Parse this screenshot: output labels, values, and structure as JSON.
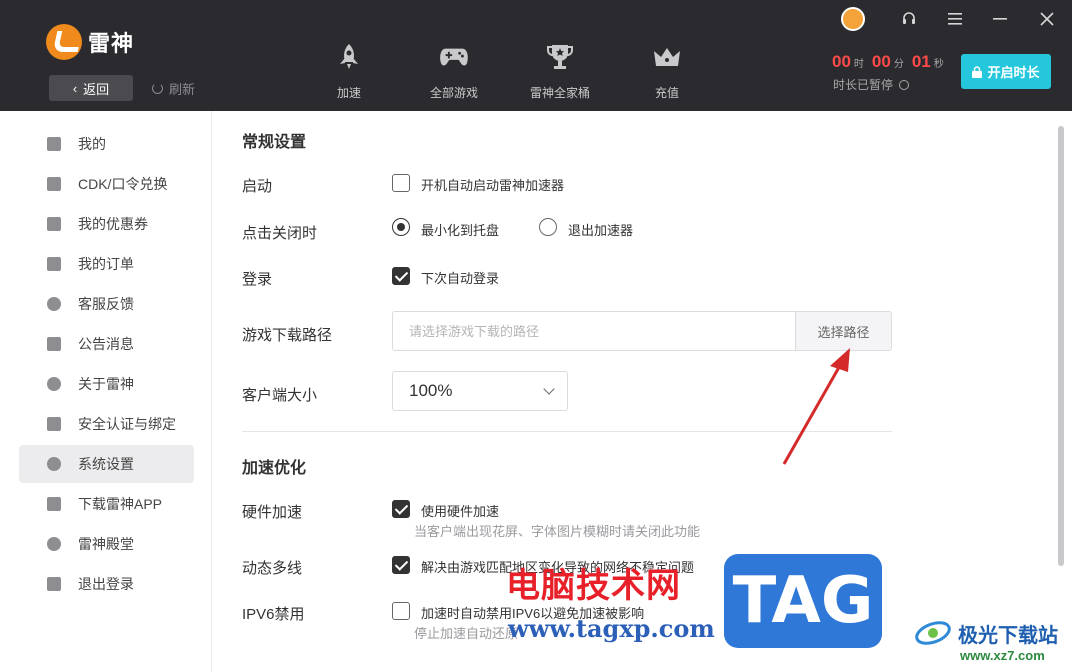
{
  "app": {
    "name": "雷神"
  },
  "header": {
    "back_label": "返回",
    "refresh_label": "刷新",
    "nav": [
      {
        "label": "加速",
        "icon": "rocket-icon"
      },
      {
        "label": "全部游戏",
        "icon": "gamepad-icon"
      },
      {
        "label": "雷神全家桶",
        "icon": "trophy-icon"
      },
      {
        "label": "充值",
        "icon": "crown-icon"
      }
    ],
    "timer": {
      "hours": "00",
      "hours_unit": "时",
      "minutes": "00",
      "minutes_unit": "分",
      "seconds": "01",
      "seconds_unit": "秒"
    },
    "paused_label": "时长已暂停",
    "start_button": "开启时长"
  },
  "sidebar": {
    "items": [
      {
        "label": "我的",
        "icon": "user-card-icon"
      },
      {
        "label": "CDK/口令兑换",
        "icon": "gift-icon"
      },
      {
        "label": "我的优惠券",
        "icon": "coupon-icon"
      },
      {
        "label": "我的订单",
        "icon": "clipboard-icon"
      },
      {
        "label": "客服反馈",
        "icon": "headset-icon"
      },
      {
        "label": "公告消息",
        "icon": "megaphone-icon"
      },
      {
        "label": "关于雷神",
        "icon": "info-icon"
      },
      {
        "label": "安全认证与绑定",
        "icon": "shield-icon"
      },
      {
        "label": "系统设置",
        "icon": "gear-icon",
        "active": true
      },
      {
        "label": "下载雷神APP",
        "icon": "phone-icon"
      },
      {
        "label": "雷神殿堂",
        "icon": "hall-icon"
      },
      {
        "label": "退出登录",
        "icon": "logout-icon"
      }
    ]
  },
  "general": {
    "title": "常规设置",
    "startup": {
      "label": "启动",
      "option": "开机自动启动雷神加速器",
      "checked": false
    },
    "on_close": {
      "label": "点击关闭时",
      "option_minimize": "最小化到托盘",
      "option_exit": "退出加速器",
      "selected": "minimize"
    },
    "login": {
      "label": "登录",
      "option": "下次自动登录",
      "checked": true
    },
    "download_path": {
      "label": "游戏下载路径",
      "placeholder": "请选择游戏下载的路径",
      "button": "选择路径"
    },
    "client_size": {
      "label": "客户端大小",
      "value": "100%"
    }
  },
  "acceleration": {
    "title": "加速优化",
    "hardware": {
      "label": "硬件加速",
      "option": "使用硬件加速",
      "hint": "当客户端出现花屏、字体图片模糊时请关闭此功能",
      "checked": true
    },
    "multiline": {
      "label": "动态多线",
      "option": "解决由游戏匹配地区变化导致的网络不稳定问题",
      "checked": true
    },
    "ipv6": {
      "label": "IPV6禁用",
      "option": "加速时自动禁用IPV6以避免加速被影响",
      "hint": "停止加速自动还原",
      "checked": false
    }
  },
  "watermarks": {
    "cn": "电脑技术网",
    "url": "www.tagxp.com",
    "tag": "TAG",
    "jg_name": "极光下载站",
    "jg_url": "www.xz7.com"
  },
  "colors": {
    "accent": "#25c7dd",
    "timer": "#ff4a4a",
    "topbar": "#2b2b2f",
    "arrow": "#d42a2a"
  }
}
